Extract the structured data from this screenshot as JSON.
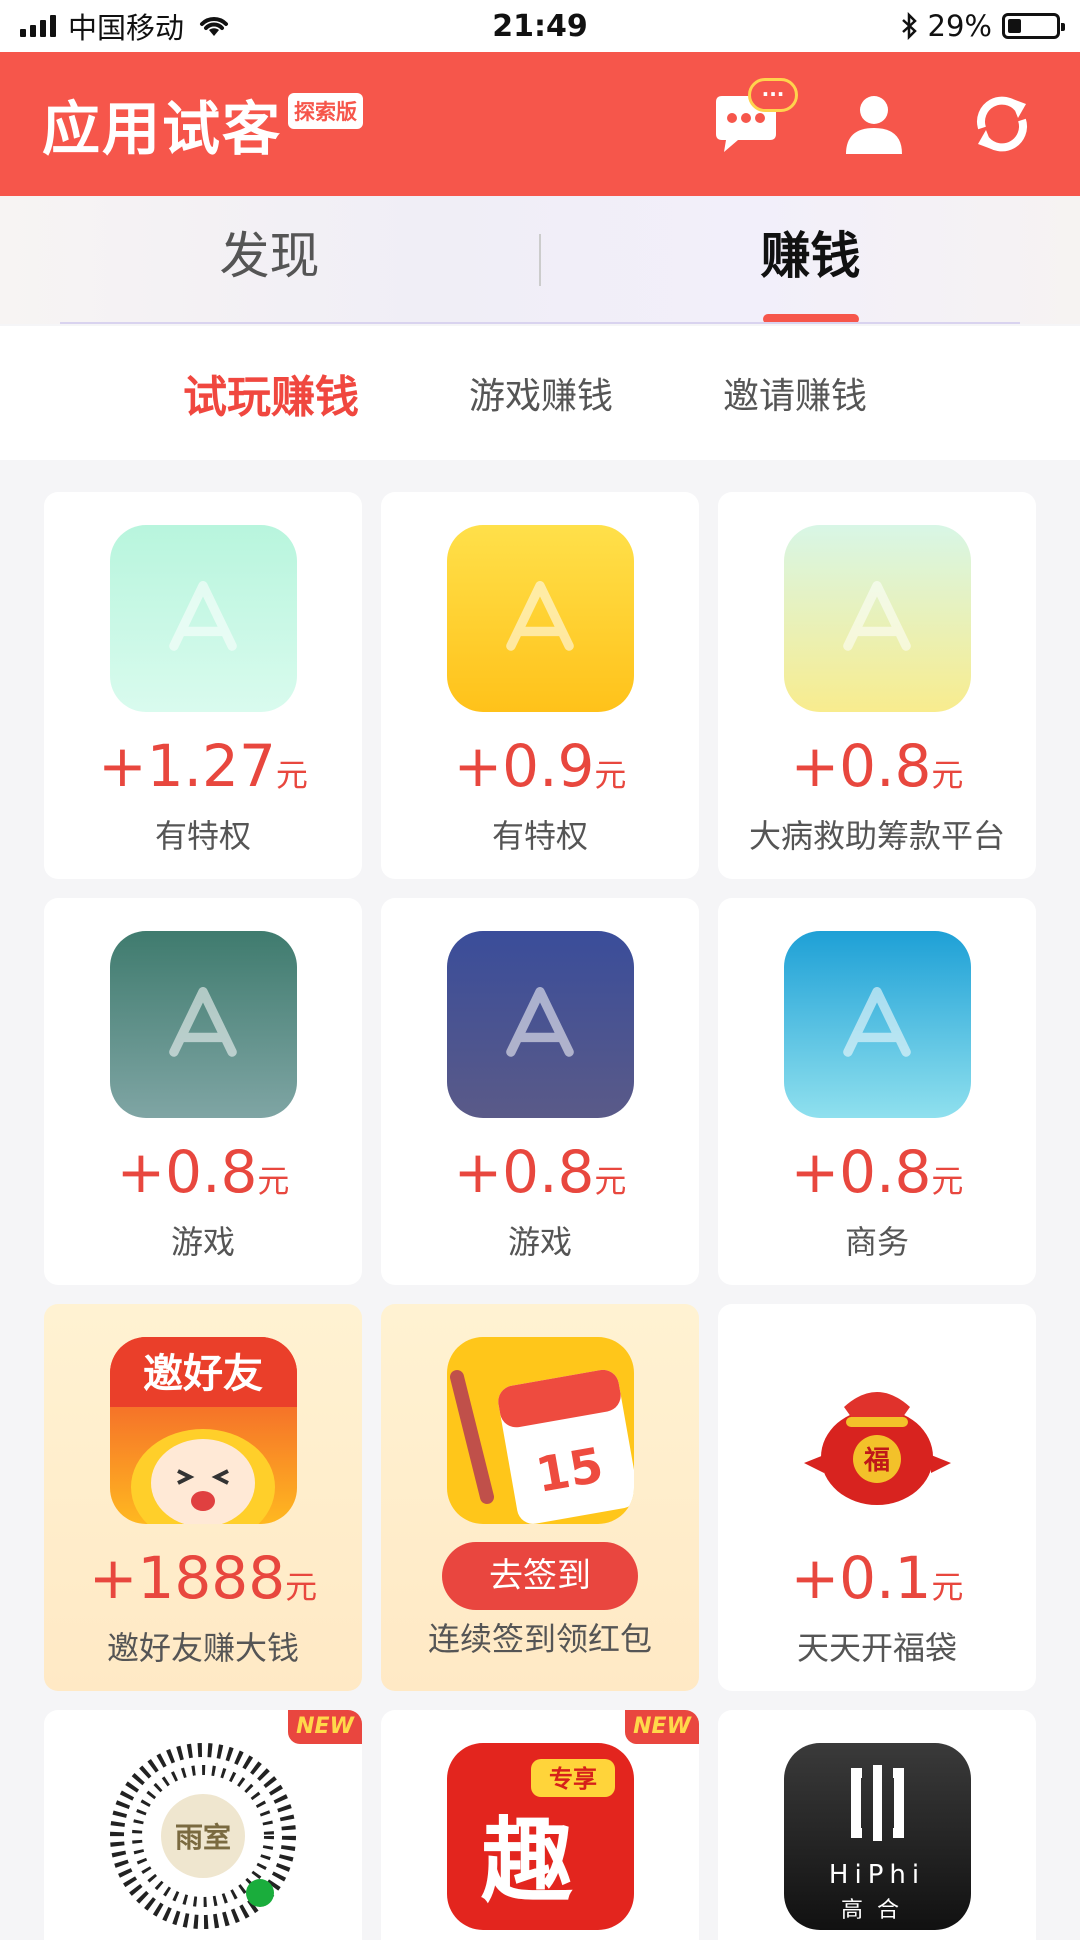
{
  "status_bar": {
    "carrier": "中国移动",
    "time": "21:49",
    "battery_pct": "29%"
  },
  "header": {
    "title": "应用试客",
    "badge": "探索版",
    "message_badge": "···"
  },
  "main_tabs": [
    {
      "label": "发现",
      "active": false
    },
    {
      "label": "赚钱",
      "active": true
    }
  ],
  "sub_tabs": [
    {
      "label": "试玩赚钱",
      "active": true
    },
    {
      "label": "游戏赚钱",
      "active": false
    },
    {
      "label": "邀请赚钱",
      "active": false
    }
  ],
  "cards": [
    {
      "price_sign": "+",
      "price": "1.27",
      "unit": "元",
      "label": "有特权",
      "icon_colors": [
        "#b8f5dd",
        "#d9fbee"
      ]
    },
    {
      "price_sign": "+",
      "price": "0.9",
      "unit": "元",
      "label": "有特权",
      "icon_colors": [
        "#ffe04a",
        "#ffc21a"
      ]
    },
    {
      "price_sign": "+",
      "price": "0.8",
      "unit": "元",
      "label": "大病救助筹款平台",
      "icon_colors": [
        "#d8f6e6",
        "#f8ec8e"
      ]
    },
    {
      "price_sign": "+",
      "price": "0.8",
      "unit": "元",
      "label": "游戏",
      "icon_colors": [
        "#3f7b6e",
        "#7fa5a4"
      ]
    },
    {
      "price_sign": "+",
      "price": "0.8",
      "unit": "元",
      "label": "游戏",
      "icon_colors": [
        "#3a4d9a",
        "#5a5a88"
      ]
    },
    {
      "price_sign": "+",
      "price": "0.8",
      "unit": "元",
      "label": "商务",
      "icon_colors": [
        "#1ea0d6",
        "#8fe0ee"
      ]
    },
    {
      "price_sign": "+",
      "price": "1888",
      "unit": "元",
      "label": "邀好友赚大钱",
      "icon_text": "邀好友"
    },
    {
      "button": "去签到",
      "label": "连续签到领红包",
      "icon_text": "15"
    },
    {
      "price_sign": "+",
      "price": "0.1",
      "unit": "元",
      "label": "天天开福袋",
      "icon_text": "福"
    }
  ],
  "bottom_cards": [
    {
      "tag": "NEW",
      "icon_text": "雨室"
    },
    {
      "tag": "NEW",
      "icon_text": "趣",
      "icon_badge": "专享"
    },
    {
      "icon_text": "HiPhi",
      "icon_subtext": "高合"
    }
  ],
  "colors": {
    "accent": "#f6564b",
    "price": "#e8473e"
  }
}
